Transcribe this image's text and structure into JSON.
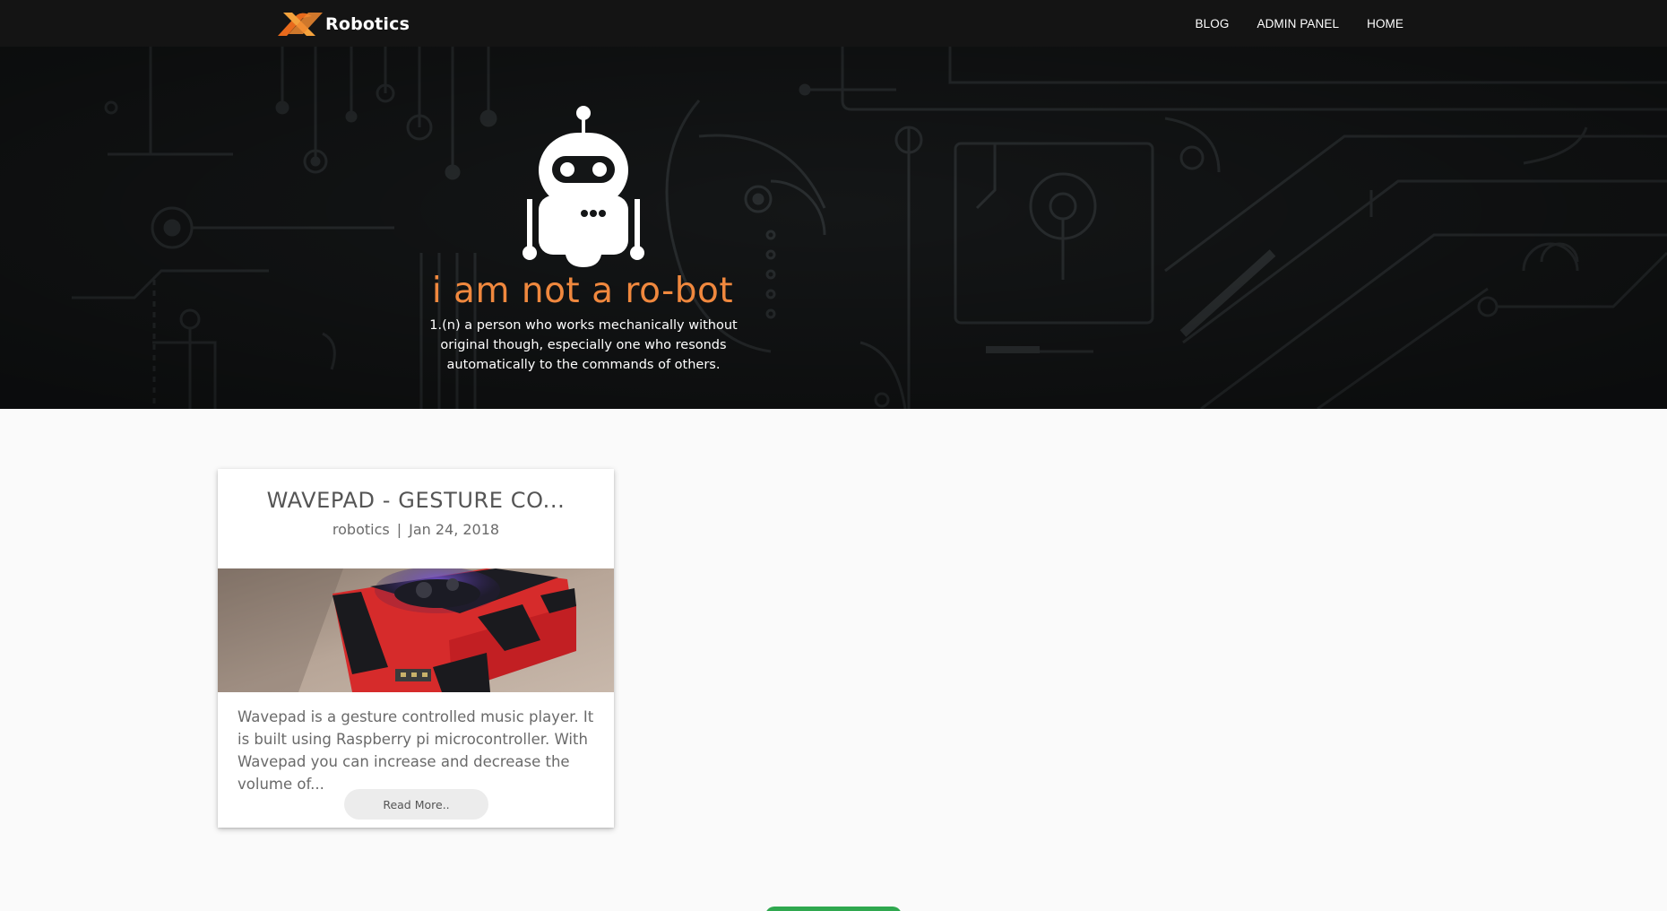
{
  "navbar": {
    "brand_text": "Robotics",
    "brand_logo_icon": "x-logo-icon",
    "links": [
      "BLOG",
      "ADMIN PANEL",
      "HOME"
    ]
  },
  "hero": {
    "title": "i am not a ro-bot",
    "description": "1.(n) a person who works mechanically without original though, especially one who resonds automatically to the commands of others.",
    "icon": "robot-icon"
  },
  "card": {
    "title": "WAVEPAD - GESTURE CO...",
    "category": "robotics",
    "separator": "|",
    "date": "Jan 24, 2018",
    "excerpt": "Wavepad is a gesture controlled music player. It is built using Raspberry pi microcontroller. With Wavepad you can increase and decrease the volume of...",
    "read_more_label": "Read More.."
  },
  "colors": {
    "accent_orange": "#f0883e",
    "navbar_bg": "#141414",
    "hero_bg": "#141617",
    "page_bg": "#fafafa",
    "bottom_green": "#2fa84f"
  }
}
